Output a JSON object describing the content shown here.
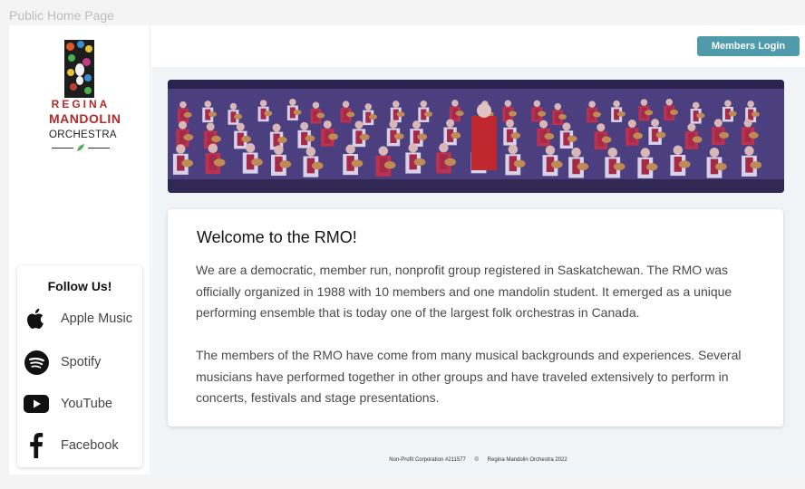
{
  "page": {
    "label": "Public Home Page"
  },
  "logo": {
    "line1": "REGINA",
    "line2": "MANDOLIN",
    "line3": "ORCHESTRA"
  },
  "header": {
    "login_label": "Members Login"
  },
  "follow": {
    "title": "Follow Us!",
    "items": [
      {
        "label": "Apple Music",
        "icon": "apple-icon"
      },
      {
        "label": "Spotify",
        "icon": "spotify-icon"
      },
      {
        "label": "YouTube",
        "icon": "youtube-icon"
      },
      {
        "label": "Facebook",
        "icon": "facebook-icon"
      }
    ]
  },
  "welcome": {
    "title": "Welcome to the RMO!",
    "paragraph1": "We are a democratic, member run, nonprofit group registered in Saskatchewan. The RMO was officially organized in 1988 with 10 members and one mandolin student.  It emerged as a unique performing ensemble that is today one of the largest folk orchestras in Canada.",
    "paragraph2": "The members of the RMO have come from many musical backgrounds and experiences. Several musicians have performed together in other groups and have traveled extensively to perform in concerts, festivals and stage presentations."
  },
  "footer": {
    "corp": "Non-Profit Corporation #211577",
    "copyright_symbol": "©",
    "org": "Regina Mandolin Orchestra 2022"
  },
  "colors": {
    "accent": "#4f9aab",
    "brand_red": "#b02a2a"
  }
}
